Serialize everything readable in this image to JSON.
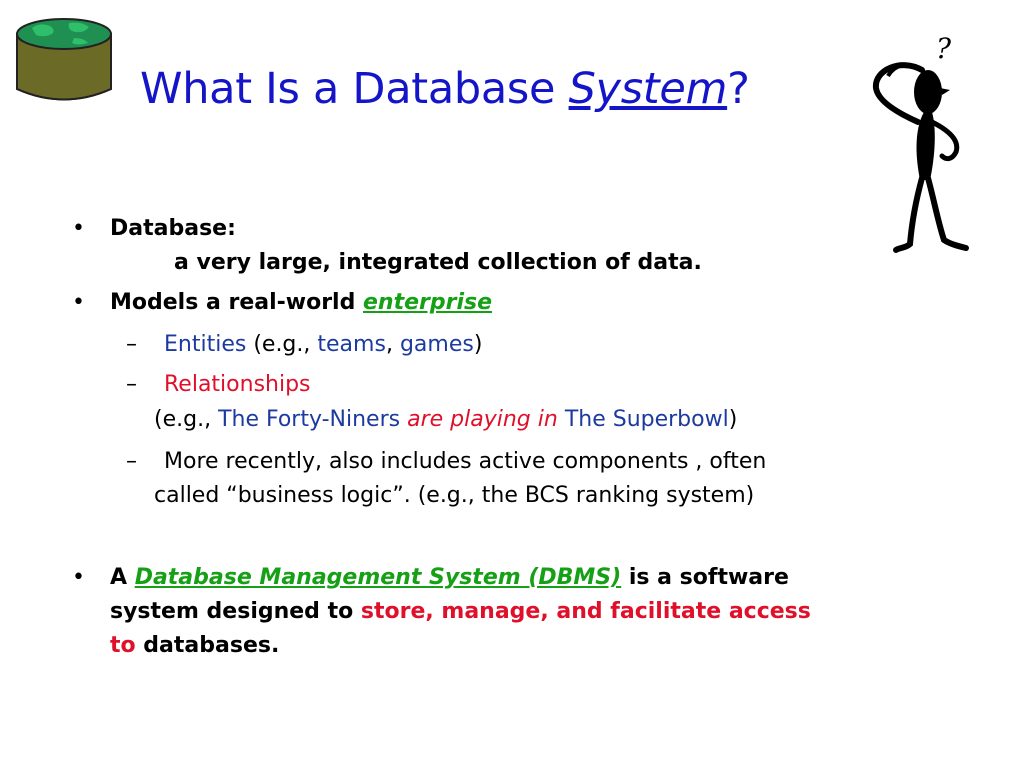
{
  "slide": {
    "title_pre": "What Is a Database ",
    "title_em": "System",
    "title_post": "?",
    "bullet_char": "•",
    "dash_char": "–",
    "b1_label": "Database:",
    "b1_def": "a very large, integrated collection of data.",
    "b2_pre": "Models a real-world ",
    "b2_em": "enterprise",
    "s1_entities": "Entities",
    "s1_eg": " (e.g., ",
    "s1_teams": "teams",
    "s1_comma": ", ",
    "s1_games": "games",
    "s1_close": ")",
    "s2_relationships": "Relationships",
    "s2_eg": "(e.g., ",
    "s2_niners": "The Forty-Niners",
    "s2_playing": " are playing in ",
    "s2_superbowl": "The Superbowl",
    "s2_close": ")",
    "s3_line1": "More recently, also includes active components , often",
    "s3_line2": "called “business logic”.  (e.g., the BCS ranking system)",
    "b3_a": "A ",
    "b3_dbms": "Database Management System (DBMS)",
    "b3_rest1": " is a software",
    "b3_line2_pre": "system designed to ",
    "b3_line2_red": "store, manage, and facilitate access",
    "b3_line3_red": "to",
    "b3_line3_post": " databases."
  },
  "icons": {
    "database": "database-cylinder-icon",
    "thinker": "thinking-stick-figure-icon",
    "question": "?"
  },
  "colors": {
    "title": "#1414c8",
    "blue_text": "#1c3aa0",
    "red_text": "#e0102a",
    "green_text": "#15a015"
  }
}
